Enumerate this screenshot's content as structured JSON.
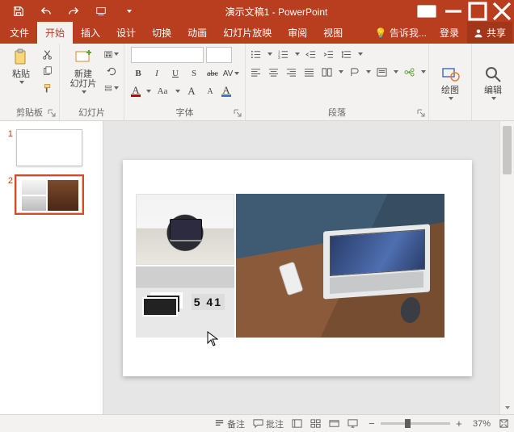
{
  "title": "演示文稿1 - PowerPoint",
  "tabs": {
    "file": "文件",
    "home": "开始",
    "insert": "插入",
    "design": "设计",
    "transitions": "切换",
    "animations": "动画",
    "slideshow": "幻灯片放映",
    "review": "审阅",
    "view": "视图"
  },
  "tellme": "告诉我...",
  "login": "登录",
  "share": "共享",
  "ribbon": {
    "clipboard": {
      "paste": "粘贴",
      "label": "剪贴板"
    },
    "slides": {
      "new": "新建\n幻灯片",
      "label": "幻灯片"
    },
    "font": {
      "label": "字体",
      "bold": "B",
      "italic": "I",
      "underline": "U",
      "strike": "abc",
      "shadow": "S",
      "spacing": "AV",
      "fontcolorA": "A",
      "highlightA": "A",
      "caseAa": "Aa",
      "clearA": "A",
      "growA": "A",
      "shrinkA": "A"
    },
    "paragraph": {
      "label": "段落"
    },
    "drawing": {
      "btn": "绘图",
      "label": ""
    },
    "editing": {
      "btn": "编辑",
      "label": ""
    }
  },
  "slides": [
    {
      "n": "1"
    },
    {
      "n": "2"
    }
  ],
  "status": {
    "notes": "备注",
    "comments": "批注",
    "zoom": "37%"
  },
  "pic2_clock": "5 41"
}
